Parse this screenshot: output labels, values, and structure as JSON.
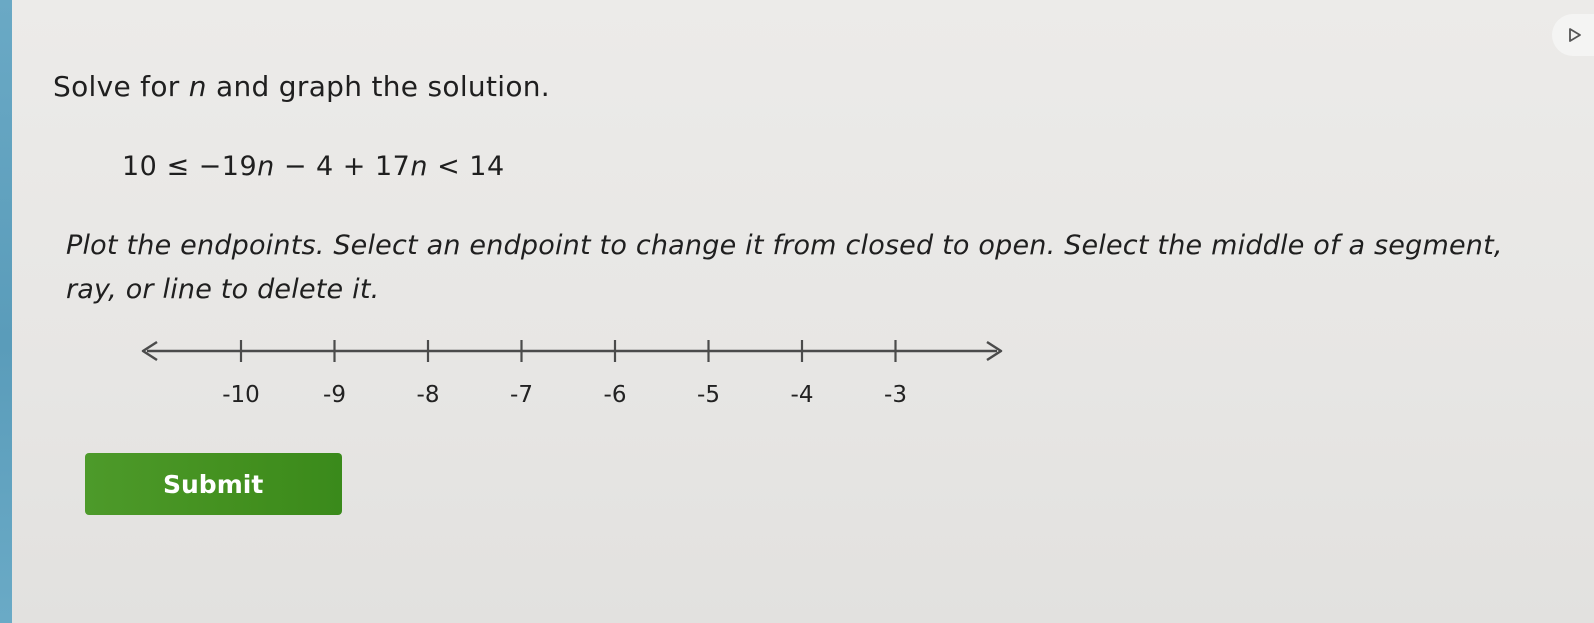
{
  "question": {
    "prompt_before_var": "Solve for ",
    "prompt_var": "n",
    "prompt_after_var": " and graph the solution."
  },
  "equation": {
    "parts": [
      "10 ≤ −19",
      "n",
      " − 4 + 17",
      "n",
      " < 14"
    ]
  },
  "instructions": "Plot the endpoints. Select an endpoint to change it from closed to open. Select the middle of a segment, ray, or line to delete it.",
  "number_line": {
    "ticks": [
      "-10",
      "-9",
      "-8",
      "-7",
      "-6",
      "-5",
      "-4",
      "-3"
    ],
    "line_color": "#4b4b4b"
  },
  "submit": {
    "label": "Submit",
    "color": "#43901f"
  },
  "icons": {
    "corner": "play-triangle-icon"
  }
}
